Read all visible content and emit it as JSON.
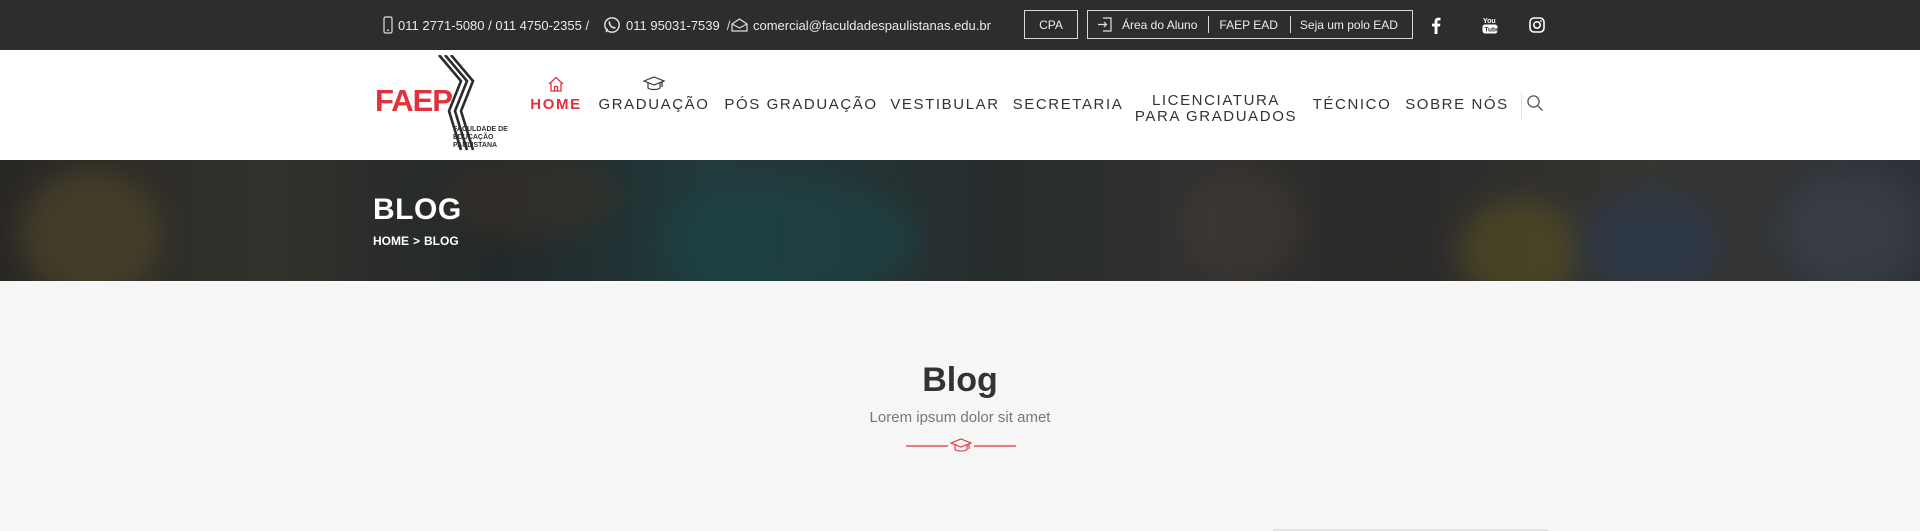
{
  "topbar": {
    "phones": "011 2771-5080 / 011 4750-2355 /",
    "whatsapp": "011 95031-7539",
    "email": "comercial@faculdadespaulistanas.edu.br",
    "cpa": "CPA",
    "portal_links": [
      "Área do Aluno",
      "FAEP EAD",
      "Seja um polo EAD"
    ],
    "social": [
      "facebook-icon",
      "youtube-icon",
      "instagram-icon"
    ]
  },
  "logo": {
    "mark": "FAEP",
    "tagline": "FACULDADE DE EDUCAÇÃO PAULISTANA"
  },
  "nav": {
    "items": [
      {
        "label": "HOME",
        "icon": "home-icon",
        "active": true
      },
      {
        "label": "GRADUAÇÃO",
        "icon": "graduation-cap-icon",
        "active": false
      },
      {
        "label": "PÓS GRADUAÇÃO",
        "active": false
      },
      {
        "label": "VESTIBULAR",
        "active": false
      },
      {
        "label": "SECRETARIA",
        "active": false
      },
      {
        "label_line1": "LICENCIATURA",
        "label_line2": "PARA GRADUADOS",
        "active": false
      },
      {
        "label": "TÉCNICO",
        "active": false
      },
      {
        "label": "SOBRE NÓS",
        "active": false
      }
    ],
    "search_icon": "search-icon"
  },
  "banner": {
    "title": "BLOG",
    "breadcrumb": {
      "home": "HOME",
      "separator": ">",
      "current": "BLOG"
    }
  },
  "section": {
    "title": "Blog",
    "subtitle": "Lorem ipsum dolor sit amet",
    "divider_icon": "graduation-cap-icon"
  },
  "colors": {
    "accent": "#e3313b",
    "topbar_bg": "#2d2d2d",
    "page_bg": "#f6f6f6"
  }
}
